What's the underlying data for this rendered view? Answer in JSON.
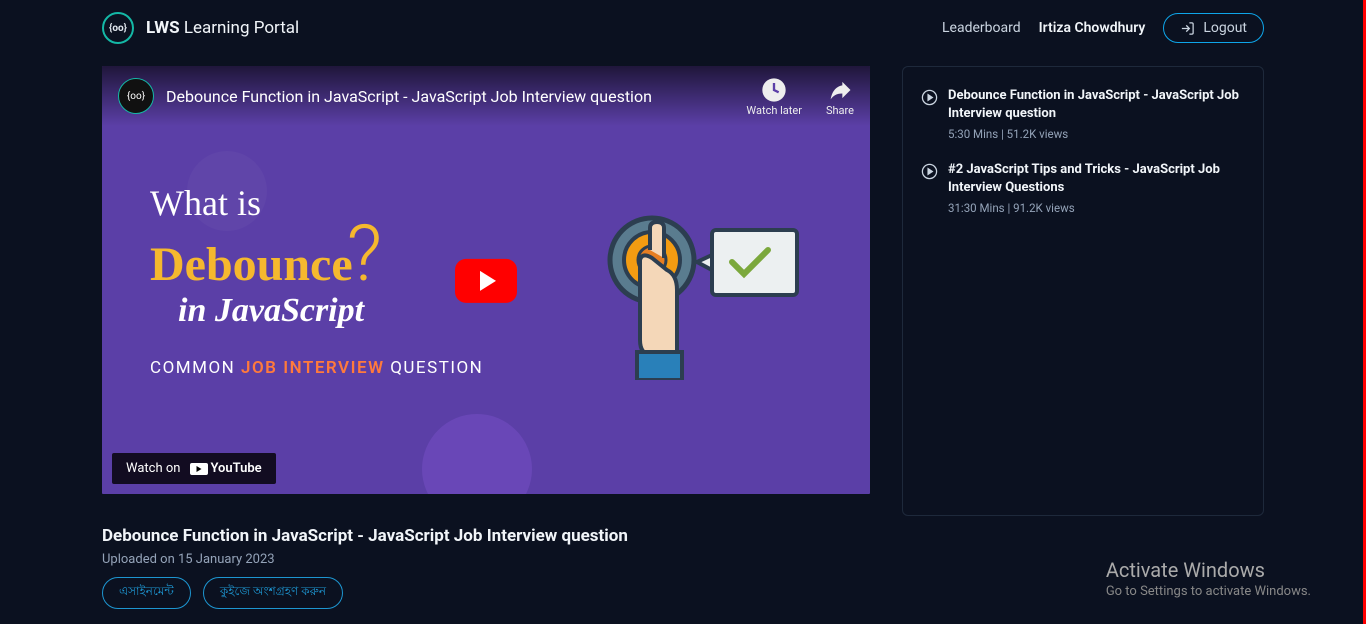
{
  "header": {
    "brand_bold": "LWS",
    "brand_light": " Learning Portal",
    "leaderboard": "Leaderboard",
    "user": "Irtiza Chowdhury",
    "logout": "Logout"
  },
  "video": {
    "yt_title": "Debounce Function in JavaScript - JavaScript Job Interview question",
    "watch_later": "Watch later",
    "share": "Share",
    "thumb_line1": "What is",
    "thumb_line2": "Debounce",
    "thumb_line3": "in JavaScript",
    "thumb_line4a": "COMMON ",
    "thumb_line4b": "JOB INTERVIEW",
    "thumb_line4c": " QUESTION",
    "watch_on": "Watch on",
    "youtube": "YouTube"
  },
  "meta": {
    "title": "Debounce Function in JavaScript - JavaScript Job Interview question",
    "uploaded": "Uploaded on 15 January 2023",
    "btn1": "এসাইনমেন্ট",
    "btn2": "কুইজে অংশগ্রহণ করুন"
  },
  "playlist": [
    {
      "title": "Debounce Function in JavaScript - JavaScript Job Interview question",
      "meta": "5:30 Mins | 51.2K views"
    },
    {
      "title": "#2 JavaScript Tips and Tricks - JavaScript Job Interview Questions",
      "meta": "31:30 Mins | 91.2K views"
    }
  ],
  "watermark": {
    "line1": "Activate Windows",
    "line2": "Go to Settings to activate Windows."
  }
}
